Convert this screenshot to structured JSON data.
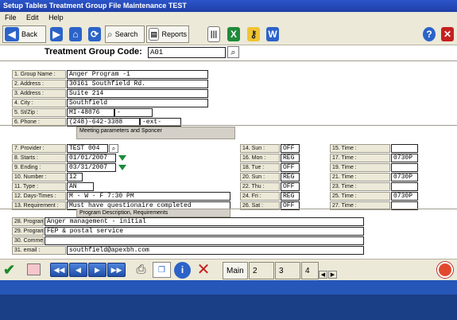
{
  "title": "Setup Tables Treatment  Group File  Maintenance TEST",
  "menu": [
    "File",
    "Edit",
    "Help"
  ],
  "toolbar": {
    "back": "Back",
    "search": "Search",
    "reports": "Reports"
  },
  "code_label": "Treatment Group Code:",
  "code_value": "A01",
  "contact_labels": [
    "1. Group Name :",
    "2. Address :",
    "3. Address :",
    "4. City :",
    "5. St/Zip :",
    "6. Phone :"
  ],
  "contact_values": [
    "Anger Program -1",
    "30161 Southfield Rd.",
    "Suite 214",
    "Southfield",
    "MI-48076",
    "(248)-642-3388"
  ],
  "zip_extra": "-",
  "phone_ext": "-ext-",
  "meeting_section": "Meeting parameters and Sponcer",
  "meeting_labels": [
    "7. Provider :",
    "8. Starts :",
    "9. Ending :",
    "10. Number :",
    "11. Type :",
    "12. Days-Times :",
    "13. Requirement :"
  ],
  "meeting_values": [
    "TEST 004",
    "01/01/2007",
    "03/31/2007",
    "12",
    "AN",
    "M - W - F      7:30 PM",
    "Must have questionaire completed"
  ],
  "days": [
    {
      "label": "14. Sun :",
      "value": "OFF"
    },
    {
      "label": "16. Mon :",
      "value": "REG"
    },
    {
      "label": "18. Tue :",
      "value": "OFF"
    },
    {
      "label": "20. Sun :",
      "value": "REG"
    },
    {
      "label": "22. Thu :",
      "value": "OFF"
    },
    {
      "label": "24. Fri :",
      "value": "REG"
    },
    {
      "label": "26. Sat :",
      "value": "OFF"
    }
  ],
  "times": [
    {
      "label": "15. Time :",
      "value": ""
    },
    {
      "label": "17. Time :",
      "value": "0730P"
    },
    {
      "label": "19. Time :",
      "value": ""
    },
    {
      "label": "21. Time :",
      "value": "0730P"
    },
    {
      "label": "23. Time :",
      "value": ""
    },
    {
      "label": "25. Time :",
      "value": "0730P"
    },
    {
      "label": "27. Time :",
      "value": ""
    }
  ],
  "program_section": "Program Description, Requirements",
  "program_labels": [
    "28. Program :",
    "29. Program :",
    "30. Comment :",
    "31. email :"
  ],
  "program_values": [
    "Anger management - initial",
    "FEP & postal service",
    "",
    "southfield@apexbh.com"
  ],
  "bottom_tabs": [
    "Main",
    "2",
    "3",
    "4"
  ],
  "colors": {
    "title": "#1f3fa7",
    "status": "#1d4fa9",
    "accent": "#2b63c9"
  }
}
